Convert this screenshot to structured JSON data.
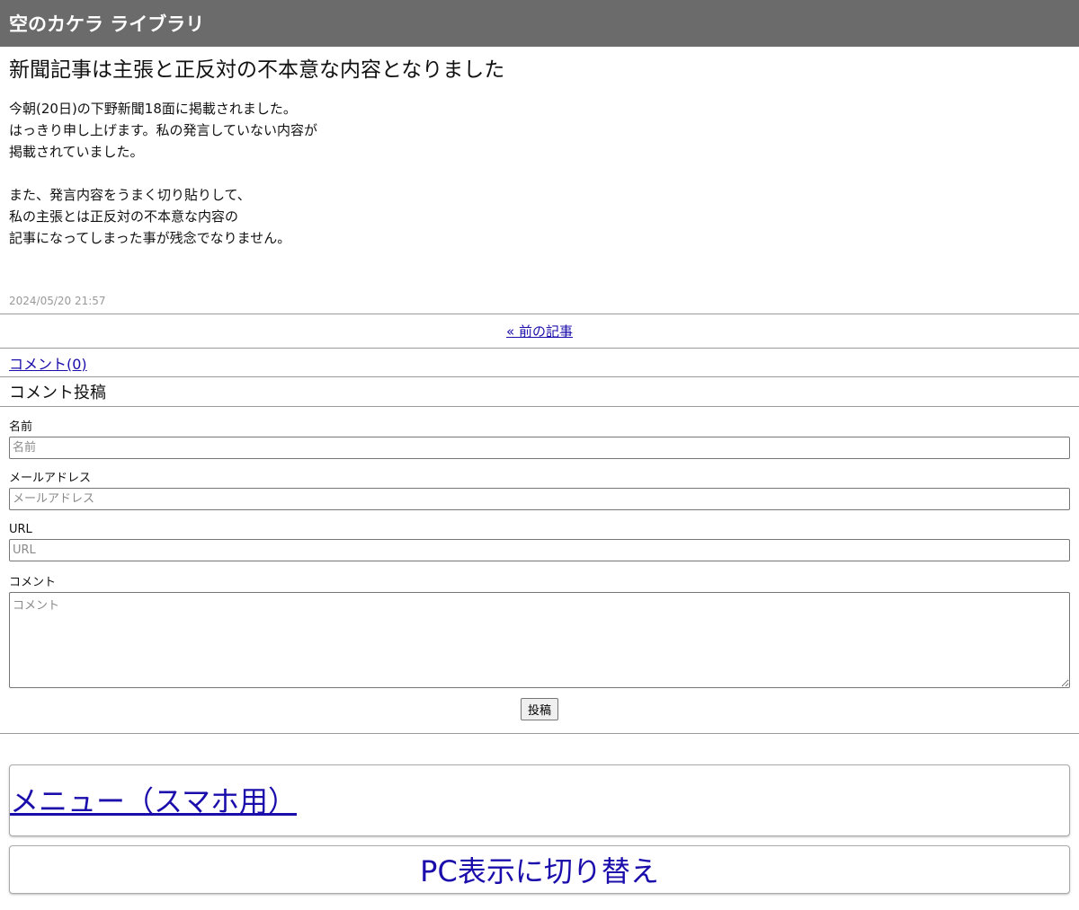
{
  "header": {
    "site_title": "空のカケラ ライブラリ"
  },
  "article": {
    "title": "新聞記事は主張と正反対の不本意な内容となりました",
    "body_lines": [
      "今朝(20日)の下野新聞18面に掲載されました。",
      "はっきり申し上げます。私の発言していない内容が",
      "掲載されていました。",
      "",
      "また、発言内容をうまく切り貼りして、",
      "私の主張とは正反対の不本意な内容の",
      "記事になってしまった事が残念でなりません。"
    ],
    "date": "2024/05/20 21:57"
  },
  "nav": {
    "prev_label": "« 前の記事"
  },
  "comments": {
    "count_label": "コメント(0)",
    "post_heading": "コメント投稿"
  },
  "form": {
    "name_label": "名前",
    "name_placeholder": "名前",
    "name_value": "",
    "email_label": "メールアドレス",
    "email_placeholder": "メールアドレス",
    "email_value": "",
    "url_label": "URL",
    "url_placeholder": "URL",
    "url_value": "",
    "comment_label": "コメント",
    "comment_placeholder": "コメント",
    "comment_value": "",
    "submit_label": "投稿"
  },
  "footer": {
    "menu_label": "メニュー（スマホ用）",
    "pc_switch_label": "PC表示に切り替え"
  },
  "colors": {
    "header_bg": "#6b6b6b",
    "link": "#1a0dab",
    "date_text": "#999999"
  }
}
